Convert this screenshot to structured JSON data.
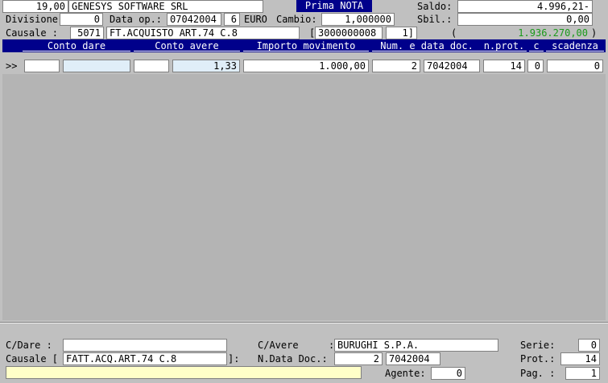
{
  "header": {
    "aliquota": "19,00",
    "company": "GENESYS SOFTWARE SRL",
    "title_badge": "Prima NOTA",
    "saldo_label": "Saldo:",
    "saldo_value": "4.996,21-",
    "divisione_label": "Divisione:",
    "divisione_value": "0",
    "data_op_label": "Data op.:",
    "data_op_value": "07042004",
    "data_op_day": "6",
    "currency": "EURO",
    "cambio_label": "Cambio:",
    "cambio_value": "1,000000",
    "sbil_label": "Sbil.:",
    "sbil_value": "0,00",
    "causale_label": "Causale  :",
    "causale_code": "5071",
    "causale_desc": "FT.ACQUISTO ART.74 C.8",
    "ref_open": "[",
    "ref_code": "3000000008",
    "ref_num": "1]",
    "total_paren_open": "(",
    "total_green": "1.936.270,00",
    "total_paren_close": ")"
  },
  "columns": [
    "Conto dare",
    "Conto avere",
    "Importo movimento",
    "Num. e data doc.",
    "n.prot.",
    "c",
    "scadenza"
  ],
  "row": {
    "marker": ">>",
    "conto_dare_a": "",
    "conto_dare_b": "",
    "conto_avere_a": "",
    "conto_avere_b": "1,33",
    "importo": "1.000,00",
    "num_doc": "2",
    "data_doc": "7042004",
    "n_prot": "14",
    "c": "0",
    "scadenza": "0"
  },
  "footer": {
    "cdare_label": "C/Dare  :",
    "cdare_value": "",
    "cavere_label": "C/Avere",
    "cavere_colon": ":",
    "cavere_value": "BURUGHI S.P.A.",
    "serie_label": "Serie:",
    "serie_value": "0",
    "causale_label": "Causale [",
    "causale_value": "FATT.ACQ.ART.74 C.8",
    "causale_close": "]:",
    "ndata_label": "N.Data Doc.:",
    "ndata_num": "2",
    "ndata_date": "7042004",
    "prot_label": "Prot.:",
    "prot_value": "14",
    "agente_label": "Agente:",
    "agente_value": "0",
    "pag_label": "Pag. :",
    "pag_value": "1",
    "message": ""
  }
}
